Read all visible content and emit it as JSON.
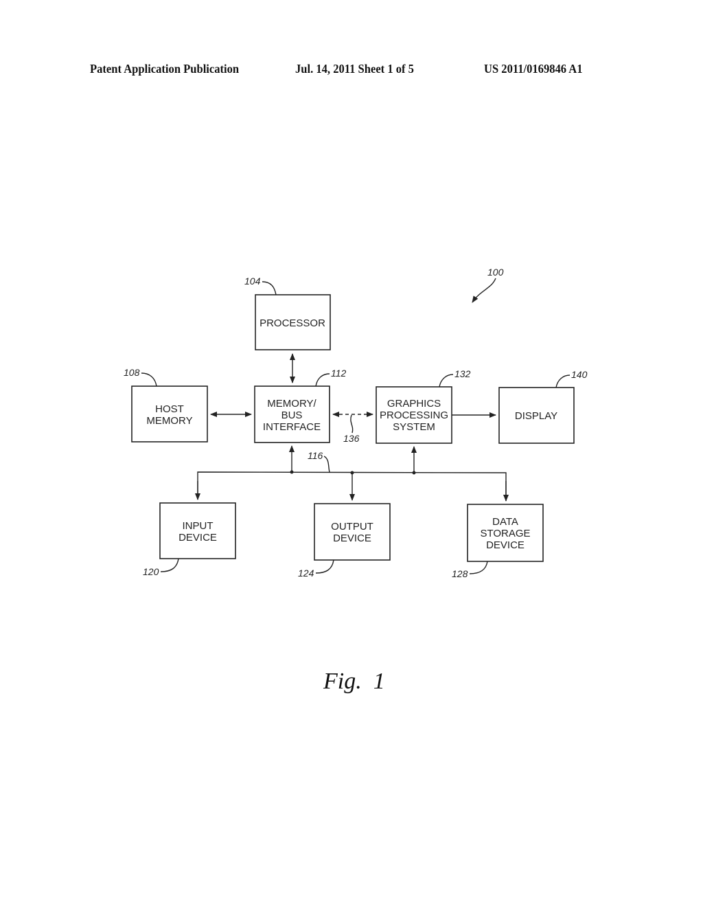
{
  "header": {
    "publication": "Patent Application Publication",
    "date_sheet": "Jul. 14, 2011   Sheet 1 of 5",
    "number": "US 2011/0169846 A1"
  },
  "figure": {
    "caption": "Fig.  1",
    "system_ref": "100",
    "blocks": {
      "processor": {
        "ref": "104",
        "lines": [
          "PROCESSOR"
        ]
      },
      "host_memory": {
        "ref": "108",
        "lines": [
          "HOST",
          "MEMORY"
        ]
      },
      "memory_bus": {
        "ref": "112",
        "lines": [
          "MEMORY/",
          "BUS",
          "INTERFACE"
        ]
      },
      "graphics": {
        "ref": "132",
        "lines": [
          "GRAPHICS",
          "PROCESSING",
          "SYSTEM"
        ]
      },
      "display": {
        "ref": "140",
        "lines": [
          "DISPLAY"
        ]
      },
      "input": {
        "ref": "120",
        "lines": [
          "INPUT",
          "DEVICE"
        ]
      },
      "output": {
        "ref": "124",
        "lines": [
          "OUTPUT",
          "DEVICE"
        ]
      },
      "storage": {
        "ref": "128",
        "lines": [
          "DATA",
          "STORAGE",
          "DEVICE"
        ]
      }
    },
    "bus_ref": "116",
    "link_ref": "136"
  }
}
